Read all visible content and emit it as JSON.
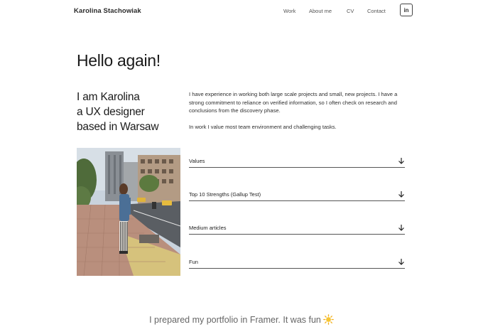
{
  "header": {
    "brand": "Karolina Stachowiak",
    "nav": [
      {
        "label": "Work"
      },
      {
        "label": "About me"
      },
      {
        "label": "CV"
      },
      {
        "label": "Contact"
      }
    ],
    "linkedin_label": "in"
  },
  "hero": {
    "greeting": "Hello again!",
    "intro_lines": [
      "I am Karolina",
      "a UX designer",
      "based in Warsaw"
    ]
  },
  "bio": {
    "paragraphs": [
      "I have experience in working both large scale projects and small, new projects. I have a strong commitment to reliance on verified information, so I often check on research and conclusions from the discovery phase.",
      "In work I value most team environment and challenging tasks."
    ]
  },
  "accordion": [
    {
      "label": "Values",
      "icon": "arrow-down-icon"
    },
    {
      "label": "Top 10 Strengths (Gallup Test)",
      "icon": "arrow-down-icon"
    },
    {
      "label": "Medium articles",
      "icon": "arrow-down-icon"
    },
    {
      "label": "Fun",
      "icon": "arrow-down-icon"
    }
  ],
  "footer": {
    "text": "I prepared my portfolio in Framer. It was fun",
    "icon": "sun-icon"
  },
  "colors": {
    "text": "#1a1a1a",
    "muted": "#666666",
    "divider": "#555555",
    "background": "#ffffff"
  }
}
